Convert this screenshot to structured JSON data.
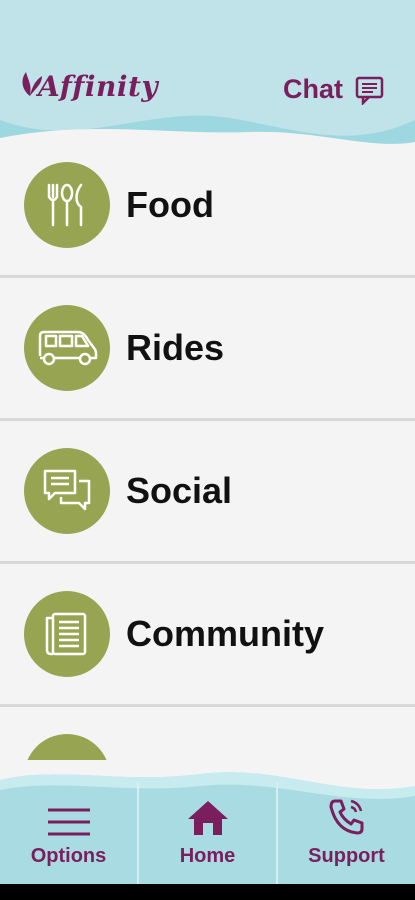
{
  "header": {
    "logo_text": "Affinity",
    "chat_label": "Chat"
  },
  "menu": {
    "items": [
      {
        "label": "Food",
        "icon": "utensils-icon"
      },
      {
        "label": "Rides",
        "icon": "van-icon"
      },
      {
        "label": "Social",
        "icon": "chat-bubbles-icon"
      },
      {
        "label": "Community",
        "icon": "newspaper-icon"
      },
      {
        "label": "",
        "icon": "partial-icon"
      }
    ]
  },
  "footer": {
    "tabs": [
      {
        "label": "Options",
        "icon": "hamburger-icon"
      },
      {
        "label": "Home",
        "icon": "home-icon"
      },
      {
        "label": "Support",
        "icon": "phone-icon"
      }
    ]
  },
  "colors": {
    "brand": "#7a1e5e",
    "accent": "#97a553",
    "header_bg": "#bfe3e8",
    "footer_bg": "#a8dce2"
  }
}
